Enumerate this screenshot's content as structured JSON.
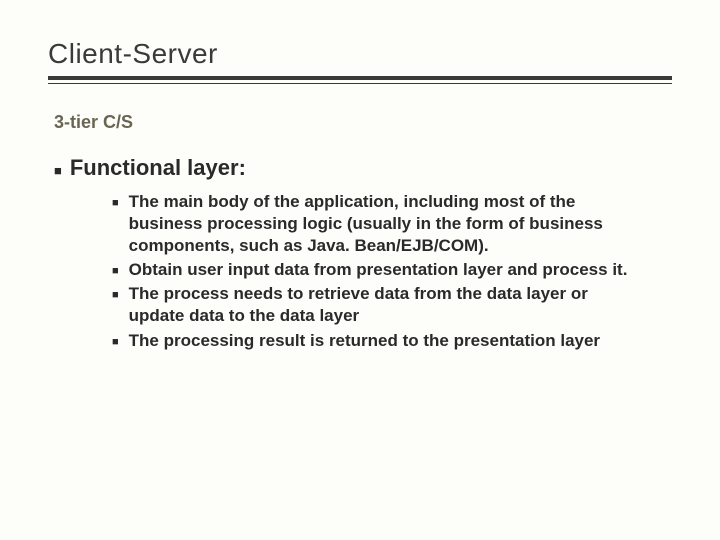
{
  "title": "Client-Server",
  "subtitle": "3-tier C/S",
  "section": {
    "header": "Functional layer:",
    "items": [
      "The main body of the application, including most of the business processing logic (usually in the form of business components, such as Java. Bean/EJB/COM).",
      "Obtain user input data from presentation layer and process it.",
      "The process needs to retrieve data from the data layer or update data to the data layer",
      "The processing result is returned to the presentation layer"
    ]
  }
}
